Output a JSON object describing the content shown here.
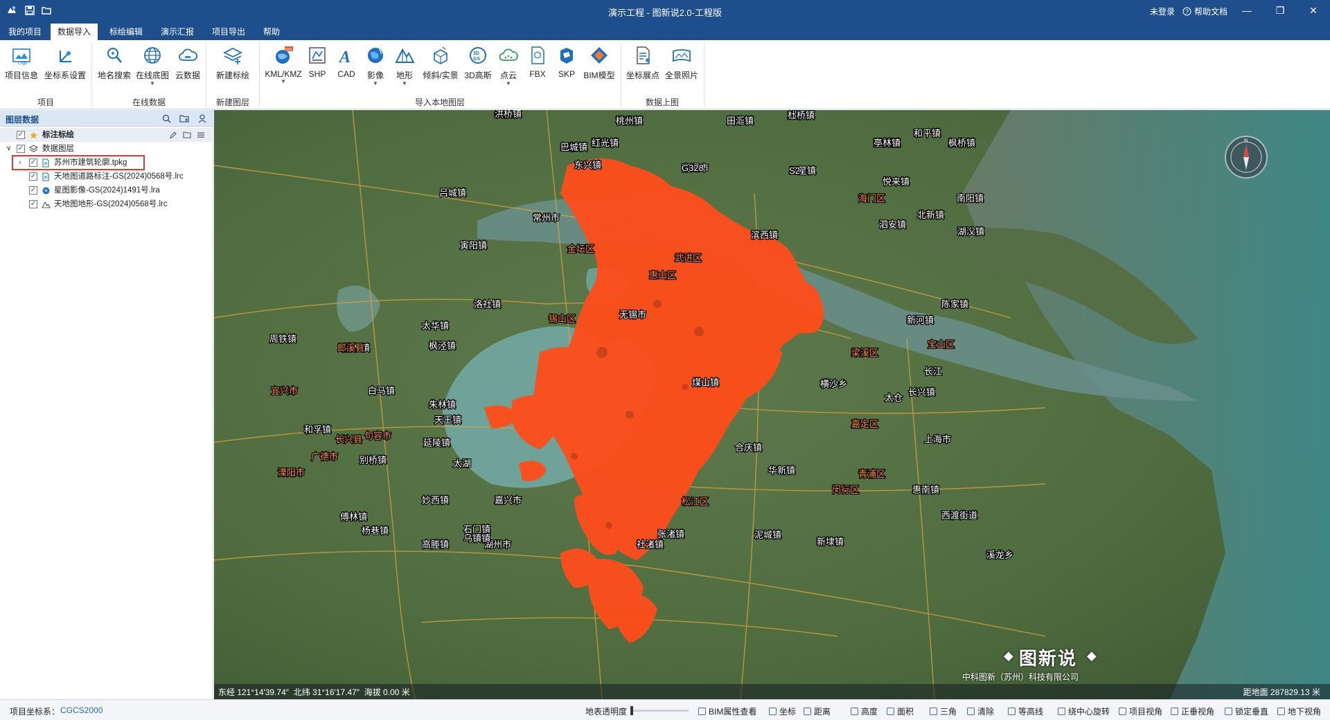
{
  "titlebar": {
    "title": "演示工程 - 图新说2.0-工程版",
    "login": "未登录",
    "help_doc": "帮助文档",
    "bg_color": "#1f4e8c"
  },
  "menu_tabs": [
    "我的项目",
    "数据导入",
    "标绘编辑",
    "演示汇报",
    "项目导出",
    "帮助"
  ],
  "active_tab": "数据导入",
  "ribbon": {
    "groups": [
      {
        "label": "项目",
        "buttons": [
          "项目信息",
          "坐标系设置"
        ]
      },
      {
        "label": "在线数据",
        "buttons": [
          "地名搜索",
          "在线底图",
          "云数据"
        ]
      },
      {
        "label": "新建图层",
        "buttons": [
          "新建标绘"
        ]
      },
      {
        "label": "导入本地图层",
        "buttons": [
          "KML/KMZ",
          "SHP",
          "CAD",
          "影像",
          "地形",
          "倾斜/实景",
          "3D高斯",
          "点云",
          "FBX",
          "SKP",
          "BIM模型"
        ]
      },
      {
        "label": "数据上图",
        "buttons": [
          "坐标展点",
          "全景照片"
        ]
      }
    ]
  },
  "layer_panel": {
    "title": "图层数据",
    "nodes": [
      {
        "label": "标注标绘",
        "icon": "star-icon",
        "checked": true
      },
      {
        "label": "数据图层",
        "icon": "layers-icon",
        "checked": true
      },
      {
        "label": "苏州市建筑轮廓.tpkg",
        "icon": "file-icon",
        "checked": true,
        "highlighted": true
      },
      {
        "label": "天地图道路标注-GS(2024)0568号.lrc",
        "icon": "file-icon",
        "checked": true
      },
      {
        "label": "星图影像-GS(2024)1491号.lra",
        "icon": "globe-icon",
        "checked": true
      },
      {
        "label": "天地图地形-GS(2024)0568号.lrc",
        "icon": "terrain-icon",
        "checked": true
      }
    ]
  },
  "map": {
    "labels": [
      "泰兴市",
      "石庄镇",
      "九华镇",
      "刘桥镇",
      "通州区",
      "正余镇",
      "虹桥镇",
      "孤山镇",
      "南通市",
      "三星镇",
      "悦来镇",
      "南阳镇",
      "东兴镇",
      "海门区",
      "北新镇",
      "吕城镇",
      "常州市",
      "寅阳镇",
      "金坛区",
      "武进区",
      "惠山区",
      "锡山区",
      "无锡市",
      "洛社镇",
      "梁溪区",
      "新河镇",
      "陈家镇",
      "滨西镇",
      "长江",
      "宝山区",
      "长兴镇",
      "横沙乡",
      "太仓",
      "嘉定区",
      "上海市",
      "合庆镇",
      "华新镇",
      "青浦区",
      "闵行区",
      "惠南镇",
      "松江区",
      "西渡街道",
      "泥城镇",
      "新埭镇",
      "嘉兴市",
      "枫泾镇",
      "湖州市",
      "和孚镇",
      "妙西镇",
      "乌镇镇",
      "石门镇",
      "太湖",
      "宜兴市",
      "溧阳市",
      "长兴县",
      "广德市",
      "洪家镇",
      "太华镇",
      "白马镇",
      "郎溪县",
      "句容市",
      "延陵镇",
      "天王镇",
      "朱林镇",
      "别桥镇",
      "傅林镇",
      "杨巷镇",
      "高塍镇",
      "周铁镇",
      "社渚镇",
      "张渚镇",
      "湖㳇镇",
      "煤山镇",
      "泗安镇",
      "和平镇",
      "溪龙乡",
      "洪桥镇",
      "桃州镇",
      "田汇镇",
      "杜桥镇",
      "亭林镇",
      "枫桥镇",
      "巴城镇",
      "红光镇",
      "G328",
      "S2"
    ],
    "brand_name": "图新说",
    "company": "中科图新（苏州）科技有限公司",
    "coord_text": "东经 121°14′39.74″  北纬 31°16′17.47″  海拔 0.00 米",
    "distance_text": "距地面 287829.13 米",
    "highlight_color": "#ff4d1a"
  },
  "statusbar": {
    "proj_coord_label": "项目坐标系：",
    "proj_coord_value": "CGCS2000",
    "opacity_label": "地表透明度",
    "tools": [
      "BIM属性查看",
      "坐标",
      "距离",
      "高度",
      "面积",
      "三角",
      "清除",
      "等高线",
      "绕中心旋转",
      "项目视角",
      "正垂视角",
      "锁定垂直",
      "地下视角"
    ]
  }
}
